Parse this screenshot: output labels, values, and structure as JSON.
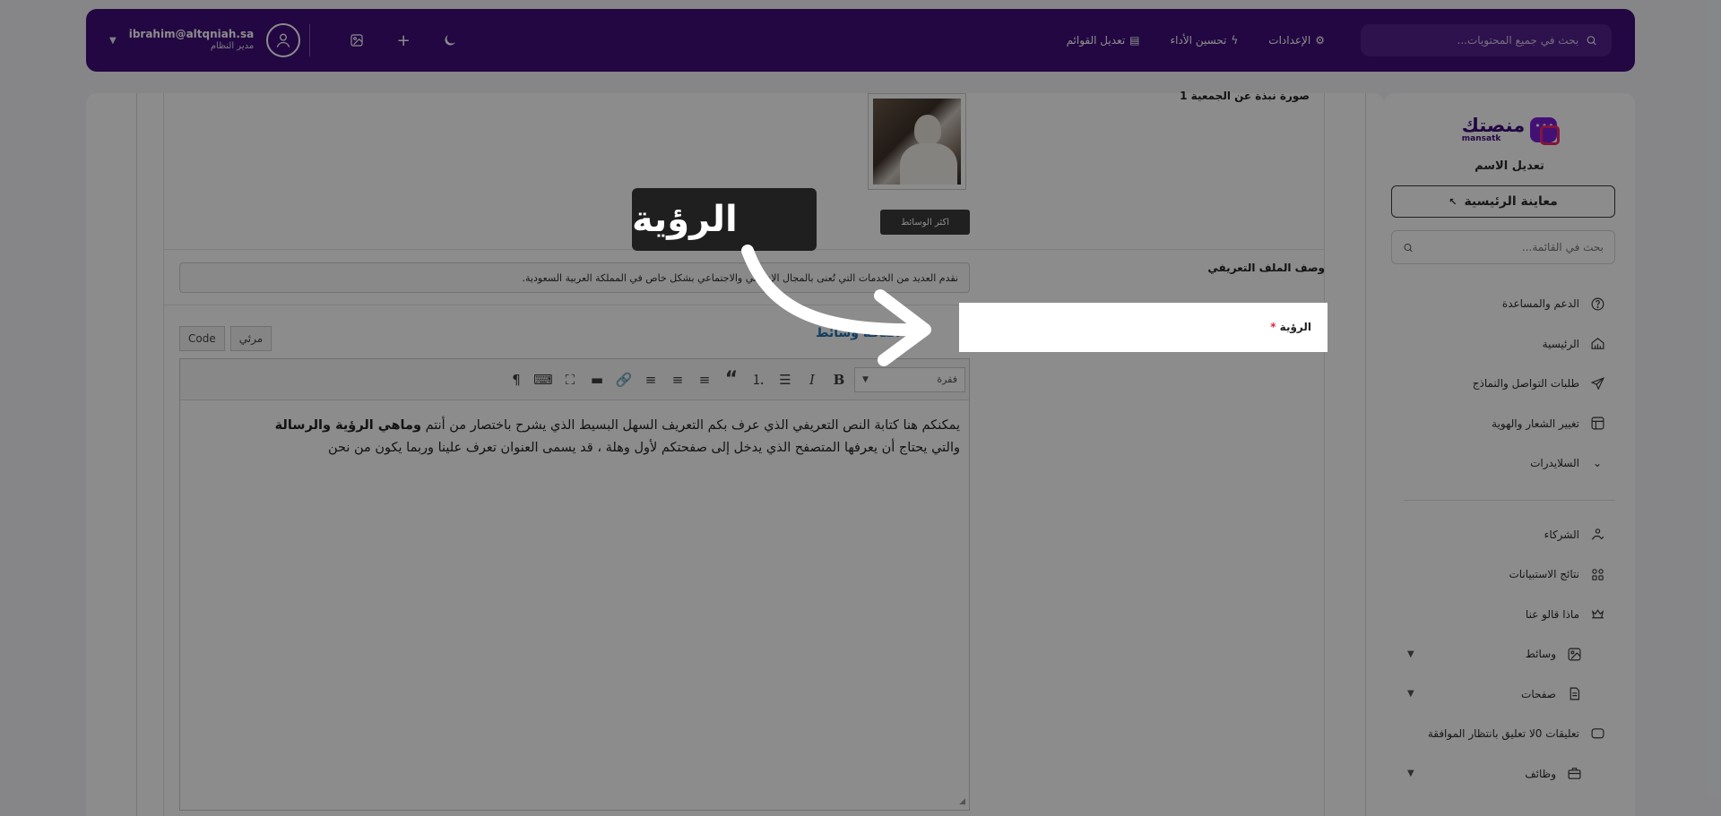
{
  "topbar": {
    "user_email": "ibrahim@altqniah.sa",
    "user_role": "مدير النظام",
    "links": [
      {
        "label": "الإعدادات",
        "icon": "gear-icon"
      },
      {
        "label": "تحسين الأداء",
        "icon": "lightning-icon"
      },
      {
        "label": "تعديل القوائم",
        "icon": "menu-layout-icon"
      }
    ],
    "search_placeholder": "بحث في جميع المحتويات..."
  },
  "sidebar": {
    "logo_ar": "منصتك",
    "logo_en": "mansatk",
    "site_name": "تعديل الاسم",
    "preview_label": "معاينة الرئيسية",
    "search_placeholder": "بحث في القائمة...",
    "items_top": [
      {
        "label": "الدعم والمساعدة",
        "icon": "help-circle-icon"
      },
      {
        "label": "الرئيسية",
        "icon": "home-icon"
      },
      {
        "label": "طلبات التواصل والنماذج",
        "icon": "send-icon"
      },
      {
        "label": "تغيير الشعار والهوية",
        "icon": "layout-icon"
      },
      {
        "label": "السلايدرات",
        "icon": "chevron-down-icon"
      }
    ],
    "items_bottom": [
      {
        "label": "الشركاء",
        "icon": "handshake-icon"
      },
      {
        "label": "نتائج الاستبيانات",
        "icon": "grid-icon"
      },
      {
        "label": "ماذا قالو عنا",
        "icon": "crown-icon"
      },
      {
        "label": "وسائط",
        "icon": "image-icon"
      },
      {
        "label": "صفحات",
        "icon": "pages-icon"
      },
      {
        "label": "تعليقات 0لا تعليق بانتظار الموافقة",
        "icon": "comment-icon"
      },
      {
        "label": "وظائف",
        "icon": "briefcase-icon"
      }
    ]
  },
  "form": {
    "photo_label": "صورة نبذة عن الجمعية 1",
    "media_button": "اكثر الوسائط",
    "desc_label": "وصف الملف التعريفي",
    "desc_value": "نقدم العديد من الخدمات التي تُعنى بالمجال الإنساني والاجتماعي بشكل خاص في المملكة العربية السعودية.",
    "vision_label": "الرؤية",
    "required_mark": "*",
    "add_media": "اضافة وسائط",
    "tab_visual": "مرئي",
    "tab_code": "Code",
    "format_select": "فقرة",
    "content_line1": "يمكنكم هنا كتابة النص التعريفي الذي عرف بكم التعريف السهل البسيط الذي يشرح باختصار من أنتم ",
    "content_bold": "وماهي الرؤية والرسالة",
    "content_line2": "والتي يحتاج أن يعرفها المتصفح الذي يدخل إلى صفحتكم لأول وهلة ، قد يسمى العنوان تعرف علينا وربما يكون من نحن"
  },
  "tour": {
    "tooltip_text": "الرؤية"
  },
  "colors": {
    "brand": "#3f0e78",
    "accent": "#f0266f",
    "required": "#e0263a",
    "link": "#2271b1"
  }
}
